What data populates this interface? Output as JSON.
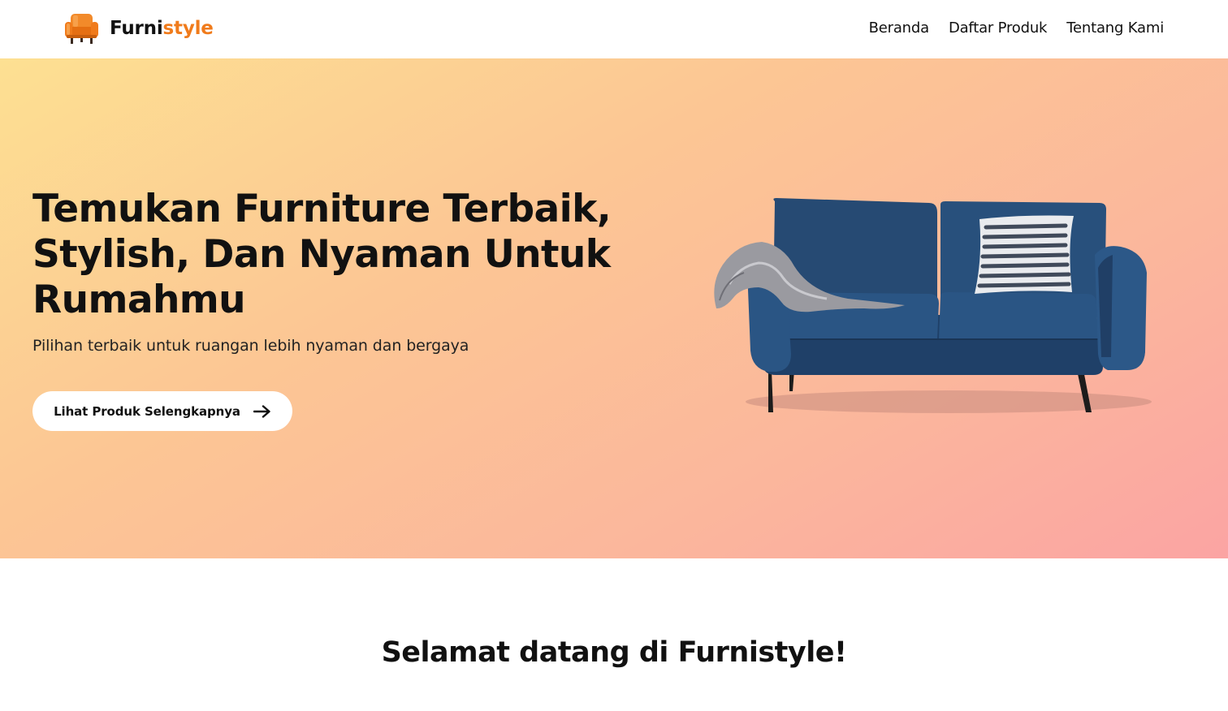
{
  "brand": {
    "name_part1": "Furni",
    "name_part2": "style",
    "logo_icon": "armchair-icon",
    "accent_color": "#f07b1b"
  },
  "nav": {
    "items": [
      {
        "label": "Beranda"
      },
      {
        "label": "Daftar Produk"
      },
      {
        "label": "Tentang Kami"
      }
    ]
  },
  "hero": {
    "title": "Temukan Furniture Terbaik, Stylish, Dan Nyaman Untuk Rumahmu",
    "subtitle": "Pilihan terbaik untuk ruangan lebih nyaman dan bergaya",
    "cta_label": "Lihat Produk Selengkapnya",
    "cta_icon": "arrow-right-icon",
    "image": "sofa-image",
    "gradient_colors": [
      "#fde092",
      "#fcc694",
      "#fbb79c",
      "#fba4a3"
    ]
  },
  "welcome": {
    "title": "Selamat datang di Furnistyle!"
  }
}
